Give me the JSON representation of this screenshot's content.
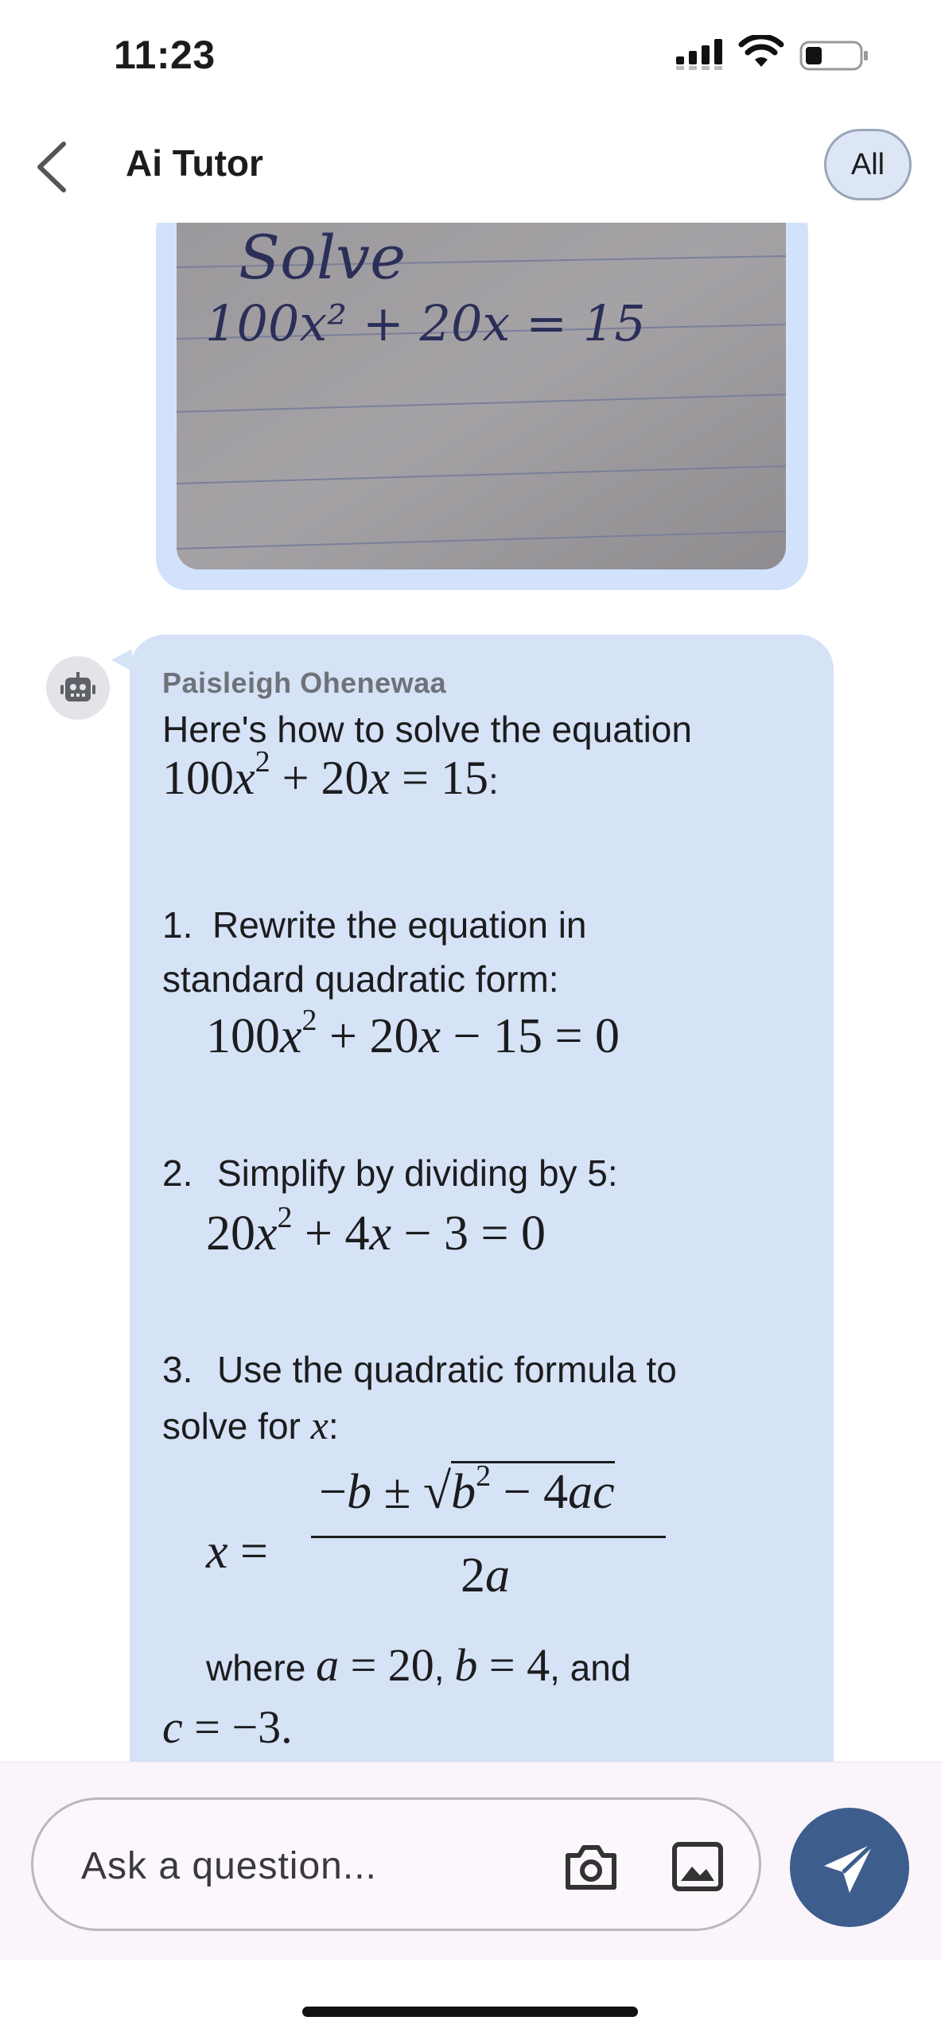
{
  "status_bar": {
    "time": "11:23",
    "icons": [
      "signal-icon",
      "wifi-icon",
      "battery-icon"
    ]
  },
  "header": {
    "title": "Ai Tutor",
    "back_icon": "chevron-left-icon",
    "filter_label": "All"
  },
  "uploaded_photo": {
    "handwriting_line1": "Solve",
    "handwriting_line2": "100x² + 20x = 15"
  },
  "message": {
    "avatar_icon": "robot-icon",
    "sender": "Paisleigh Ohenewaa",
    "intro": "Here's how to solve the equation",
    "equation": "100x² + 20x = 15:",
    "step1_number": "1.",
    "step1_line1": "Rewrite the equation in",
    "step1_line2": "standard quadratic form:",
    "step1_math": "100x² + 20x − 15 = 0",
    "step2_number": "2.",
    "step2_text": "Simplify by dividing by 5:",
    "step2_math": "20x² + 4x − 3 = 0",
    "step3_number": "3.",
    "step3_line1": "Use the quadratic formula to",
    "step3_line2": "solve for x:",
    "formula_lhs": "x =",
    "formula_numerator": "−b ± √(b² − 4ac)",
    "formula_denominator": "2a",
    "where_text": "where a = 20, b = 4, and",
    "c_value": "c = −3."
  },
  "composer": {
    "placeholder": "Ask a question...",
    "camera_icon": "camera-icon",
    "gallery_icon": "image-icon",
    "send_icon": "send-icon"
  },
  "colors": {
    "bubble": "#d6e2f6",
    "image_bubble": "#d2e2fb",
    "send_button": "#3d5d8c",
    "composer_bg": "#fbf4fb"
  }
}
